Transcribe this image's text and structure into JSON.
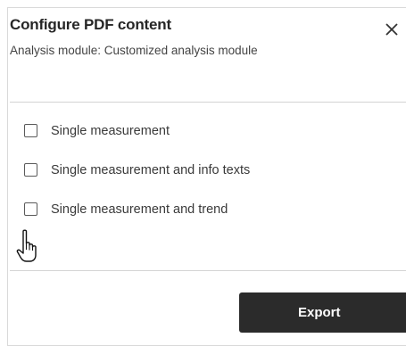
{
  "dialog": {
    "title": "Configure PDF content",
    "subtitle": "Analysis module: Customized analysis module",
    "close_icon": "close-icon"
  },
  "options": [
    {
      "label": "Single measurement",
      "checked": false
    },
    {
      "label": "Single measurement and info texts",
      "checked": false
    },
    {
      "label": "Single measurement and trend",
      "checked": false
    }
  ],
  "footer": {
    "export_label": "Export"
  },
  "cursor": {
    "icon": "hand-pointer-icon"
  },
  "colors": {
    "button_bg": "#2b2b2b",
    "button_text": "#ffffff",
    "divider": "#d4d4d4",
    "checkbox_border": "#5a5a5a"
  }
}
